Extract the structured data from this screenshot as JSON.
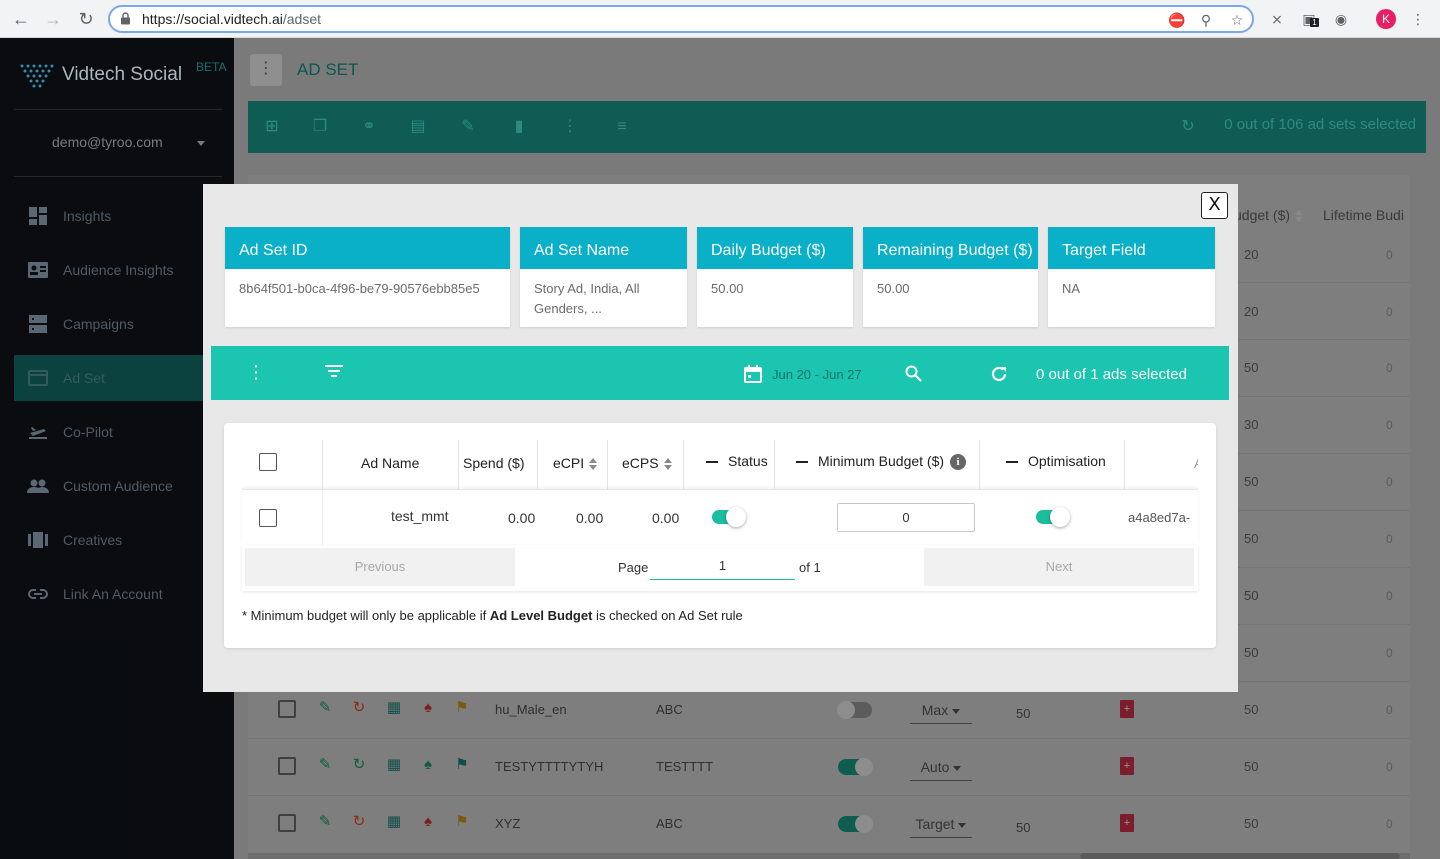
{
  "browser": {
    "url_host": "https://social.vidtech.ai",
    "url_path": "/adset",
    "avatar_letter": "K",
    "ext_badge": "1"
  },
  "sidebar": {
    "brand": "Vidtech Social",
    "beta": "BETA",
    "user": "demo@tyroo.com",
    "items": [
      {
        "label": "Insights",
        "icon": "dashboard-icon"
      },
      {
        "label": "Audience Insights",
        "icon": "audience-card-icon"
      },
      {
        "label": "Campaigns",
        "icon": "campaigns-icon"
      },
      {
        "label": "Ad Set",
        "icon": "adset-icon",
        "active": true
      },
      {
        "label": "Co-Pilot",
        "icon": "flight-icon"
      },
      {
        "label": "Custom Audience",
        "icon": "people-icon"
      },
      {
        "label": "Creatives",
        "icon": "carousel-icon"
      },
      {
        "label": "Link An Account",
        "icon": "link-icon"
      }
    ]
  },
  "page": {
    "title": "AD SET",
    "selected_count": "0 out of 106 ad sets selected",
    "bg_headers": {
      "budget": "udget ($)",
      "lifetime": "Lifetime Budi"
    }
  },
  "bg_rows": [
    {
      "budget": "20",
      "lifetime": "0"
    },
    {
      "budget": "20",
      "lifetime": "0"
    },
    {
      "budget": "50",
      "lifetime": "0"
    },
    {
      "budget": "30",
      "lifetime": "0"
    },
    {
      "budget": "50",
      "lifetime": "0"
    },
    {
      "budget": "50",
      "lifetime": "0"
    },
    {
      "budget": "50",
      "lifetime": "0"
    },
    {
      "budget": "50",
      "lifetime": "0"
    },
    {
      "name": "hu_Male_en",
      "group": "ABC",
      "bid": "Max",
      "num": "50",
      "budget": "50",
      "lifetime": "0",
      "toggle": false
    },
    {
      "name": "TESTYTTTTYTYH",
      "group": "TESTTTT",
      "bid": "Auto",
      "num": "",
      "budget": "50",
      "lifetime": "0",
      "toggle": true
    },
    {
      "name": "XYZ",
      "group": "ABC",
      "bid": "Target",
      "num": "50",
      "budget": "50",
      "lifetime": "0",
      "toggle": true
    }
  ],
  "modal": {
    "close_label": "X",
    "cards": [
      {
        "head": "Ad Set ID",
        "value": "8b64f501-b0ca-4f96-be79-90576ebb85e5"
      },
      {
        "head": "Ad Set Name",
        "value": "Story Ad, India, All Genders, ..."
      },
      {
        "head": "Daily Budget ($)",
        "value": "50.00"
      },
      {
        "head": "Remaining Budget ($)",
        "value": "50.00"
      },
      {
        "head": "Target Field",
        "value": "NA"
      }
    ],
    "date_range": "Jun 20 - Jun 27",
    "ads_selected": "0 out of 1 ads selected",
    "columns": {
      "ad_name": "Ad Name",
      "spend": "Spend ($)",
      "ecpi": "eCPI",
      "ecps": "eCPS",
      "status": "Status",
      "min_budget": "Minimum Budget ($)",
      "optimisation": "Optimisation",
      "cut": "A"
    },
    "row": {
      "ad_name": "test_mmt",
      "spend": "0.00",
      "ecpi": "0.00",
      "ecps": "0.00",
      "status_on": true,
      "min_budget": "0",
      "optimisation_on": true,
      "ad_id_partial": "a4a8ed7a-"
    },
    "pager": {
      "previous": "Previous",
      "page_label": "Page",
      "page": "1",
      "of_label": "of 1",
      "next": "Next"
    },
    "note": {
      "pre": "* Minimum budget will only be applicable if ",
      "bold": "Ad Level Budget",
      "post": " is checked on Ad Set rule"
    }
  }
}
